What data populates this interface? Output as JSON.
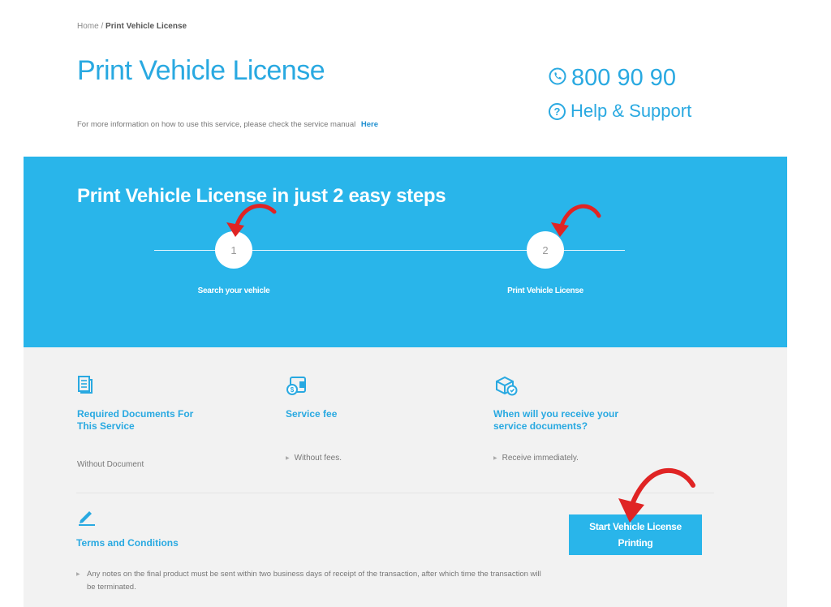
{
  "breadcrumb": {
    "home": "Home",
    "separator": "/",
    "current": "Print Vehicle License"
  },
  "header": {
    "title": "Print Vehicle License",
    "info_text": "For more information on how to use this service, please check the service manual",
    "info_link": "Here",
    "phone": "800 90 90",
    "help": "Help & Support"
  },
  "steps": {
    "title": "Print Vehicle License in just 2 easy steps",
    "items": [
      {
        "number": "1",
        "label": "Search your vehicle"
      },
      {
        "number": "2",
        "label": "Print Vehicle License"
      }
    ]
  },
  "info": {
    "documents": {
      "icon": "document-icon",
      "title": "Required Documents For This Service",
      "text": "Without Document"
    },
    "fee": {
      "icon": "wallet-icon",
      "title": "Service fee",
      "text": "Without fees."
    },
    "delivery": {
      "icon": "delivery-icon",
      "title": "When will you receive your service documents?",
      "text": "Receive immediately."
    }
  },
  "terms": {
    "icon": "pencil-icon",
    "title": "Terms and Conditions",
    "text": "Any notes on the final product must be sent within two business days of receipt of the transaction, after which time the transaction will be terminated."
  },
  "start_button": {
    "label": "Start Vehicle License Printing"
  },
  "colors": {
    "accent": "#29a9e1",
    "banner": "#29b5ea",
    "panel": "#f2f2f2",
    "annotation_arrow": "#e02424"
  }
}
